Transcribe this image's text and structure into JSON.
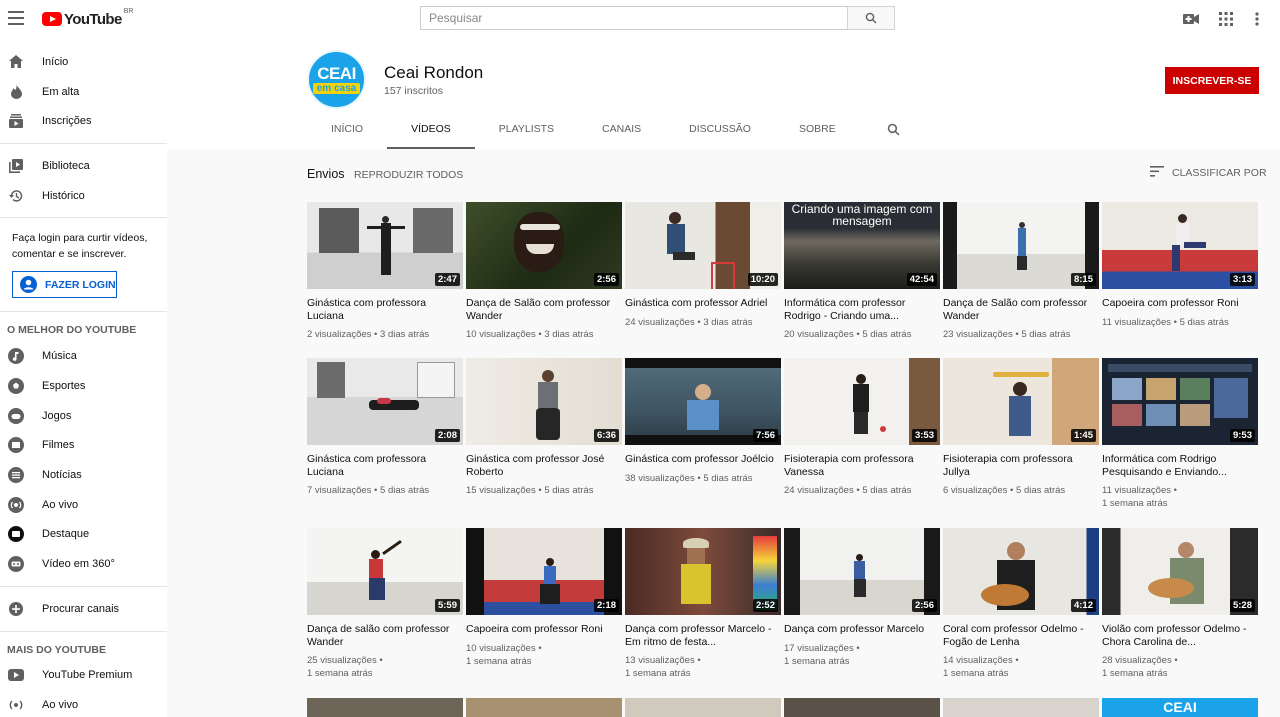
{
  "header": {
    "logo_text": "YouTube",
    "logo_country": "BR",
    "search_placeholder": "Pesquisar"
  },
  "sidebar": {
    "main": [
      {
        "label": "Início",
        "icon": "home-icon"
      },
      {
        "label": "Em alta",
        "icon": "flame-icon"
      },
      {
        "label": "Inscrições",
        "icon": "subscriptions-icon"
      }
    ],
    "library": [
      {
        "label": "Biblioteca",
        "icon": "library-icon"
      },
      {
        "label": "Histórico",
        "icon": "history-icon"
      }
    ],
    "login_text": "Faça login para curtir vídeos, comentar e se inscrever.",
    "login_button": "FAZER LOGIN",
    "best_title": "O MELHOR DO YOUTUBE",
    "best": [
      {
        "label": "Música",
        "icon": "music-icon"
      },
      {
        "label": "Esportes",
        "icon": "sports-icon"
      },
      {
        "label": "Jogos",
        "icon": "gaming-icon"
      },
      {
        "label": "Filmes",
        "icon": "movies-icon"
      },
      {
        "label": "Notícias",
        "icon": "news-icon"
      },
      {
        "label": "Ao vivo",
        "icon": "live-icon"
      },
      {
        "label": "Destaque",
        "icon": "spotlight-icon"
      },
      {
        "label": "Vídeo em 360°",
        "icon": "vr-icon"
      }
    ],
    "browse_channels": "Procurar canais",
    "more_title": "MAIS DO YOUTUBE",
    "more": [
      {
        "label": "YouTube Premium",
        "icon": "youtube-premium-icon"
      },
      {
        "label": "Ao vivo",
        "icon": "live-icon"
      }
    ]
  },
  "channel": {
    "avatar_top": "CEAI",
    "avatar_bottom": "em casa",
    "name": "Ceai Rondon",
    "subscribers": "157 inscritos",
    "subscribe_label": "INSCREVER-SE",
    "tabs": [
      "INÍCIO",
      "VÍDEOS",
      "PLAYLISTS",
      "CANAIS",
      "DISCUSSÃO",
      "SOBRE"
    ],
    "active_tab": "VÍDEOS"
  },
  "uploads": {
    "title": "Envios",
    "play_all": "REPRODUZIR TODOS",
    "sort_label": "CLASSIFICAR POR"
  },
  "videos": [
    {
      "title": "Ginástica com professora Luciana",
      "duration": "2:47",
      "views": "2 visualizações",
      "age": "3 dias atrás",
      "caption": ""
    },
    {
      "title": "Dança de Salão com professor Wander",
      "duration": "2:56",
      "views": "10 visualizações",
      "age": "3 dias atrás",
      "caption": ""
    },
    {
      "title": "Ginástica com professor Adriel",
      "duration": "10:20",
      "views": "24 visualizações",
      "age": "3 dias atrás",
      "caption": ""
    },
    {
      "title": "Informática com professor Rodrigo - Criando uma...",
      "duration": "42:54",
      "views": "20 visualizações",
      "age": "5 dias atrás",
      "caption": "Criando uma imagem com mensagem"
    },
    {
      "title": "Dança de Salão com professor Wander",
      "duration": "8:15",
      "views": "23 visualizações",
      "age": "5 dias atrás",
      "caption": ""
    },
    {
      "title": "Capoeira com professor Roni",
      "duration": "3:13",
      "views": "11 visualizações",
      "age": "5 dias atrás",
      "caption": ""
    },
    {
      "title": "Ginástica com professora Luciana",
      "duration": "2:08",
      "views": "7 visualizações",
      "age": "5 dias atrás",
      "caption": ""
    },
    {
      "title": "Ginástica com professor José Roberto",
      "duration": "6:36",
      "views": "15 visualizações",
      "age": "5 dias atrás",
      "caption": ""
    },
    {
      "title": "Ginástica com professor Joélcio",
      "duration": "7:56",
      "views": "38 visualizações",
      "age": "5 dias atrás",
      "caption": ""
    },
    {
      "title": "Fisioterapia com professora Vanessa",
      "duration": "3:53",
      "views": "24 visualizações",
      "age": "5 dias atrás",
      "caption": ""
    },
    {
      "title": "Fisioterapia com professora Jullya",
      "duration": "1:45",
      "views": "6 visualizações",
      "age": "5 dias atrás",
      "caption": ""
    },
    {
      "title": "Informática com Rodrigo Pesquisando e Enviando...",
      "duration": "9:53",
      "views": "11 visualizações",
      "age": "1 semana atrás",
      "caption": ""
    },
    {
      "title": "Dança de salão com professor Wander",
      "duration": "5:59",
      "views": "25 visualizações",
      "age": "1 semana atrás",
      "caption": ""
    },
    {
      "title": "Capoeira com professor Roni",
      "duration": "2:18",
      "views": "10 visualizações",
      "age": "1 semana atrás",
      "caption": ""
    },
    {
      "title": "Dança com professor Marcelo - Em ritmo de festa...",
      "duration": "2:52",
      "views": "13 visualizações",
      "age": "1 semana atrás",
      "caption": ""
    },
    {
      "title": "Dança com professor Marcelo",
      "duration": "2:56",
      "views": "17 visualizações",
      "age": "1 semana atrás",
      "caption": ""
    },
    {
      "title": "Coral com professor Odelmo - Fogão de Lenha",
      "duration": "4:12",
      "views": "14 visualizações",
      "age": "1 semana atrás",
      "caption": ""
    },
    {
      "title": "Violão com professor Odelmo - Chora Carolina de...",
      "duration": "5:28",
      "views": "28 visualizações",
      "age": "1 semana atrás",
      "caption": ""
    }
  ],
  "partial_row_caption": "CEAI",
  "colors": {
    "subscribe": "#cc0000",
    "login_blue": "#065fd4",
    "avatar_blue": "#1aa3e8",
    "avatar_yellow": "#f4d20a"
  }
}
